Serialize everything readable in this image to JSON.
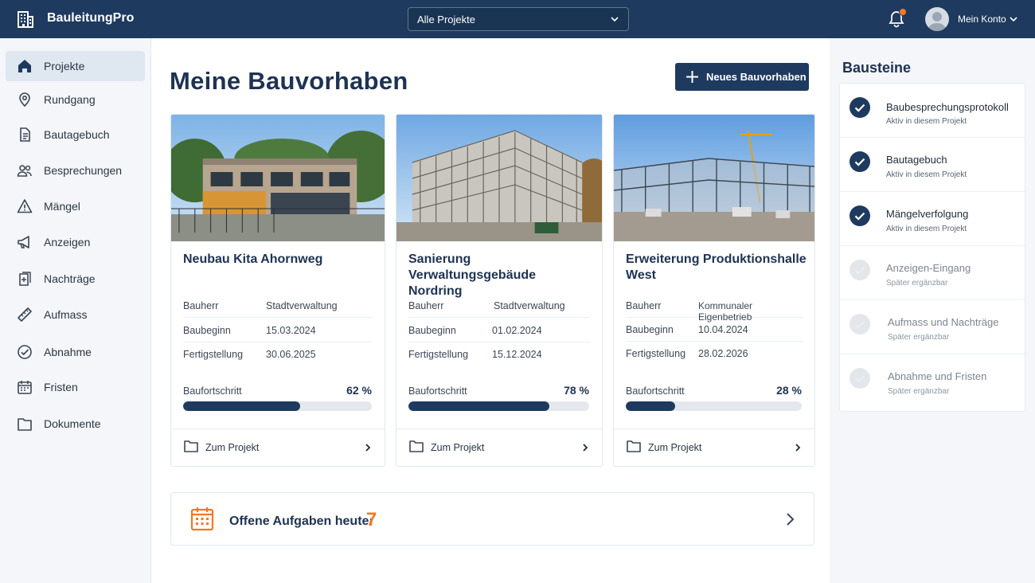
{
  "app": {
    "name": "BauleitungPro"
  },
  "header": {
    "project_select": "Alle Projekte",
    "account_label": "Mein Konto"
  },
  "sidebar": {
    "items": [
      {
        "label": "Projekte",
        "icon": "home-icon",
        "active": true
      },
      {
        "label": "Rundgang",
        "icon": "map-pin-icon"
      },
      {
        "label": "Bautagebuch",
        "icon": "document-icon"
      },
      {
        "label": "Besprechungen",
        "icon": "users-icon"
      },
      {
        "label": "Mängel",
        "icon": "warning-icon"
      },
      {
        "label": "Anzeigen",
        "icon": "megaphone-icon"
      },
      {
        "label": "Nachträge",
        "icon": "documents-plus-icon"
      },
      {
        "label": "Aufmass",
        "icon": "ruler-icon"
      },
      {
        "label": "Abnahme",
        "icon": "check-circle-icon"
      },
      {
        "label": "Fristen",
        "icon": "calendar-icon"
      },
      {
        "label": "Dokumente",
        "icon": "folder-icon"
      }
    ]
  },
  "main": {
    "title": "Meine Bauvorhaben",
    "new_button": "Neues Bauvorhaben",
    "projects": [
      {
        "title": "Neubau Kita Ahornweg",
        "rows": [
          {
            "key": "Bauherr",
            "value": "Stadtverwaltung"
          },
          {
            "key": "Baubeginn",
            "value": "15.03.2024"
          },
          {
            "key": "Fertigstellung",
            "value": "30.06.2025"
          }
        ],
        "progress_label": "Baufortschritt",
        "progress": 62,
        "progress_text": "62 %",
        "link": "Zum Projekt"
      },
      {
        "title": "Sanierung Verwaltungsgebäude Nordring",
        "rows": [
          {
            "key": "Bauherr",
            "value": "Stadtverwaltung"
          },
          {
            "key": "Baubeginn",
            "value": "01.02.2024"
          },
          {
            "key": "Fertigstellung",
            "value": "15.12.2024"
          }
        ],
        "progress_label": "Baufortschritt",
        "progress": 78,
        "progress_text": "78 %",
        "link": "Zum Projekt"
      },
      {
        "title": "Erweiterung Produktionshalle West",
        "rows": [
          {
            "key": "Bauherr",
            "value": "Kommunaler Eigenbetrieb"
          },
          {
            "key": "Baubeginn",
            "value": "10.04.2024"
          },
          {
            "key": "Fertigstellung",
            "value": "28.02.2026"
          }
        ],
        "progress_label": "Baufortschritt",
        "progress": 28,
        "progress_text": "28 %",
        "link": "Zum Projekt"
      }
    ],
    "tasks": {
      "label": "Offene Aufgaben heute:",
      "count": "7"
    }
  },
  "modules": {
    "title": "Bausteine",
    "items": [
      {
        "title": "Baubesprechungsprotokoll",
        "status": "Aktiv in diesem Projekt",
        "active": true
      },
      {
        "title": "Bautagebuch",
        "status": "Aktiv in diesem Projekt",
        "active": true
      },
      {
        "title": "Mängelverfolgung",
        "status": "Aktiv in diesem Projekt",
        "active": true
      },
      {
        "title": "Anzeigen-Eingang",
        "status": "Später ergänzbar",
        "active": false
      },
      {
        "title": "Aufmass und Nachträge",
        "status": "Später ergänzbar",
        "active": false
      },
      {
        "title": "Abnahme und Fristen",
        "status": "Später ergänzbar",
        "active": false
      }
    ]
  },
  "colors": {
    "primary": "#1e3a5f",
    "accent": "#f07a22",
    "background": "#f4f6f9"
  }
}
